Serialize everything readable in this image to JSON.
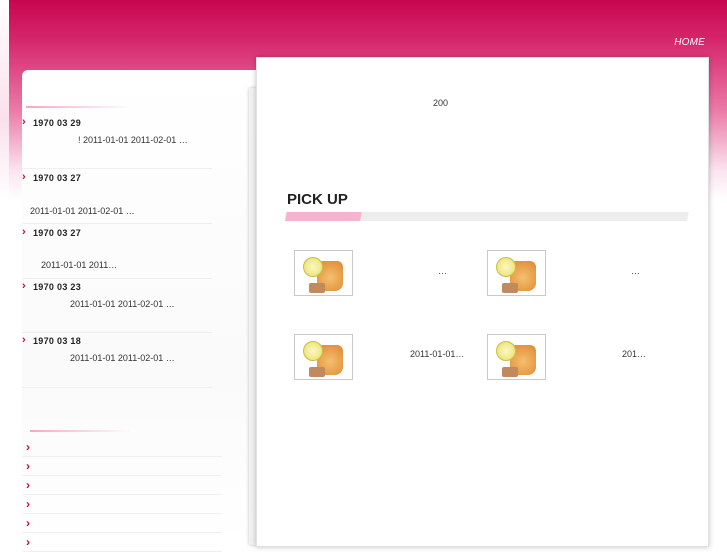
{
  "header": {
    "home_label": "HOME"
  },
  "banner": {
    "text": "200"
  },
  "news": [
    {
      "date": "1970  03  29",
      "text": "!     2011-01-01   2011-02-01    …"
    },
    {
      "date": "1970  03  27",
      "text": "2011-01-01   2011-02-01         …"
    },
    {
      "date": "1970  03  27",
      "text": "2011-01-01   2011…"
    },
    {
      "date": "1970  03  23",
      "text": "2011-01-01   2011-02-01         …"
    },
    {
      "date": "1970  03  18",
      "text": "2011-01-01   2011-02-01         …"
    }
  ],
  "pickup": {
    "title": "PICK UP",
    "items": [
      {
        "label": "…",
        "image": "iced-tea-lemon"
      },
      {
        "label": "…",
        "image": "iced-tea-lemon"
      },
      {
        "label": "2011-01-01…",
        "image": "iced-tea-lemon"
      },
      {
        "label": "201…",
        "image": "iced-tea-lemon"
      }
    ]
  },
  "menu": {
    "item_count": 6,
    "icon": "chevron-right-icon"
  },
  "colors": {
    "accent": "#c8064f",
    "pink_light": "#f5b3cf"
  }
}
